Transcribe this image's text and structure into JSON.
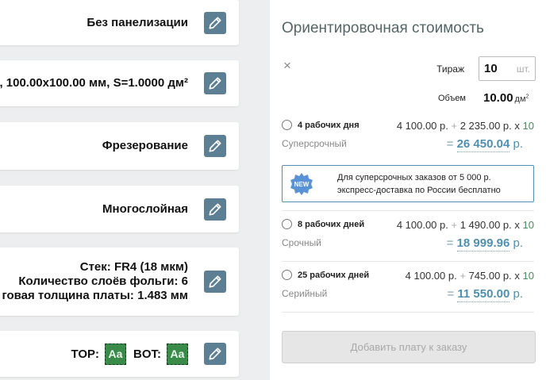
{
  "cards": {
    "panelization": "Без панелизации",
    "size": ", 100.00x100.00 мм, S=1.0000 дм²",
    "milling": "Фрезерование",
    "multilayer": "Многослойная",
    "stack_line1": "Стек: FR4 (18 мкм)",
    "stack_line2": "Количество слоёв фольги: 6",
    "stack_line3": "говая толщина платы: 1.483 мм",
    "top_label": "TOP:",
    "bot_label": "BOT:",
    "aa_top": "Aa",
    "aa_bot": "Aa"
  },
  "right": {
    "title": "Ориентировочная стоимость",
    "close": "×",
    "tirazh_label": "Тираж",
    "tirazh_value": "10",
    "tirazh_unit": "шт.",
    "volume_label": "Объем",
    "volume_value": "10.00",
    "volume_unit": "дм",
    "volume_sup": "2",
    "options": [
      {
        "days": "4 рабочих дня",
        "type": "Суперсрочный",
        "base": "4 100.00 р.",
        "plus": "+",
        "per": "2 235.00 р.",
        "mult": "x",
        "qty": "10",
        "eq": "=",
        "total": "26 450.04",
        "currency": "р."
      },
      {
        "days": "8 рабочих дней",
        "type": "Срочный",
        "base": "4 100.00 р.",
        "plus": "+",
        "per": "1 490.00 р.",
        "mult": "x",
        "qty": "10",
        "eq": "=",
        "total": "18 999.96",
        "currency": "р."
      },
      {
        "days": "25 рабочих дней",
        "type": "Серийный",
        "base": "4 100.00 р.",
        "plus": "+",
        "per": "745.00 р.",
        "mult": "x",
        "qty": "10",
        "eq": "=",
        "total": "11 550.00",
        "currency": "р."
      }
    ],
    "promo_badge": "NEW",
    "promo_line1": "Для суперсрочных заказов от 5 000 р.",
    "promo_line2": "экспресс-доставка по России бесплатно",
    "order_button": "Добавить плату к заказу"
  },
  "colors": {
    "edit_button": "#5d7f93",
    "accent_blue": "#4f8fb0",
    "qty_green": "#4a8a5a",
    "layer_green": "#3a8a4a"
  },
  "icons": {
    "edit": "pencil-icon",
    "close": "close-icon",
    "badge": "new-badge-icon"
  }
}
